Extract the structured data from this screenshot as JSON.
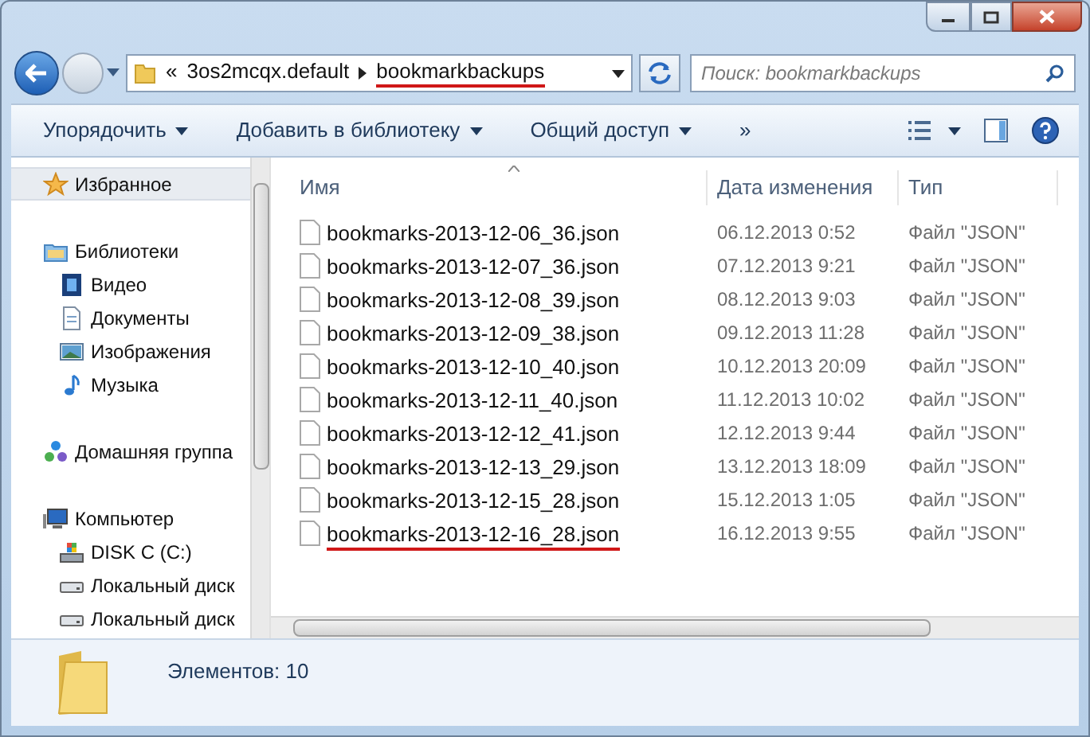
{
  "address_bar": {
    "breadcrumbs": [
      {
        "label": "«",
        "underlined": false
      },
      {
        "label": "3os2mcqx.default",
        "underlined": false
      },
      {
        "label": "bookmarkbackups",
        "underlined": true
      }
    ]
  },
  "search": {
    "placeholder": "Поиск: bookmarkbackups"
  },
  "toolbar": {
    "items": [
      {
        "label": "Упорядочить",
        "dropdown": true
      },
      {
        "label": "Добавить в библиотеку",
        "dropdown": true
      },
      {
        "label": "Общий доступ",
        "dropdown": true
      },
      {
        "label": "»",
        "dropdown": false
      }
    ]
  },
  "sidebar": {
    "items": [
      {
        "label": "Избранное",
        "kind": "star",
        "selected": true
      },
      {
        "label": "Библиотеки",
        "kind": "library",
        "selected": false,
        "children": [
          {
            "label": "Видео",
            "kind": "video",
            "selected": false
          },
          {
            "label": "Документы",
            "kind": "document",
            "selected": false
          },
          {
            "label": "Изображения",
            "kind": "image",
            "selected": false
          },
          {
            "label": "Музыка",
            "kind": "music",
            "selected": false
          }
        ]
      },
      {
        "label": "Домашняя группа",
        "kind": "homegroup",
        "selected": false
      },
      {
        "label": "Компьютер",
        "kind": "computer",
        "selected": false,
        "children": [
          {
            "label": "DISK C (C:)",
            "kind": "system-drive",
            "selected": false
          },
          {
            "label": "Локальный диск",
            "kind": "drive",
            "selected": false
          },
          {
            "label": "Локальный диск",
            "kind": "drive",
            "selected": false
          }
        ]
      }
    ]
  },
  "table": {
    "columns": [
      "Имя",
      "Дата изменения",
      "Тип"
    ],
    "rows": [
      {
        "name": "bookmarks-2013-12-06_36.json",
        "date": "06.12.2013 0:52",
        "type": "Файл \"JSON\"",
        "underlined": false
      },
      {
        "name": "bookmarks-2013-12-07_36.json",
        "date": "07.12.2013 9:21",
        "type": "Файл \"JSON\"",
        "underlined": false
      },
      {
        "name": "bookmarks-2013-12-08_39.json",
        "date": "08.12.2013 9:03",
        "type": "Файл \"JSON\"",
        "underlined": false
      },
      {
        "name": "bookmarks-2013-12-09_38.json",
        "date": "09.12.2013 11:28",
        "type": "Файл \"JSON\"",
        "underlined": false
      },
      {
        "name": "bookmarks-2013-12-10_40.json",
        "date": "10.12.2013 20:09",
        "type": "Файл \"JSON\"",
        "underlined": false
      },
      {
        "name": "bookmarks-2013-12-11_40.json",
        "date": "11.12.2013 10:02",
        "type": "Файл \"JSON\"",
        "underlined": false
      },
      {
        "name": "bookmarks-2013-12-12_41.json",
        "date": "12.12.2013 9:44",
        "type": "Файл \"JSON\"",
        "underlined": false
      },
      {
        "name": "bookmarks-2013-12-13_29.json",
        "date": "13.12.2013 18:09",
        "type": "Файл \"JSON\"",
        "underlined": false
      },
      {
        "name": "bookmarks-2013-12-15_28.json",
        "date": "15.12.2013 1:05",
        "type": "Файл \"JSON\"",
        "underlined": false
      },
      {
        "name": "bookmarks-2013-12-16_28.json",
        "date": "16.12.2013 9:55",
        "type": "Файл \"JSON\"",
        "underlined": true
      }
    ]
  },
  "status_bar": {
    "text": "Элементов: 10"
  }
}
